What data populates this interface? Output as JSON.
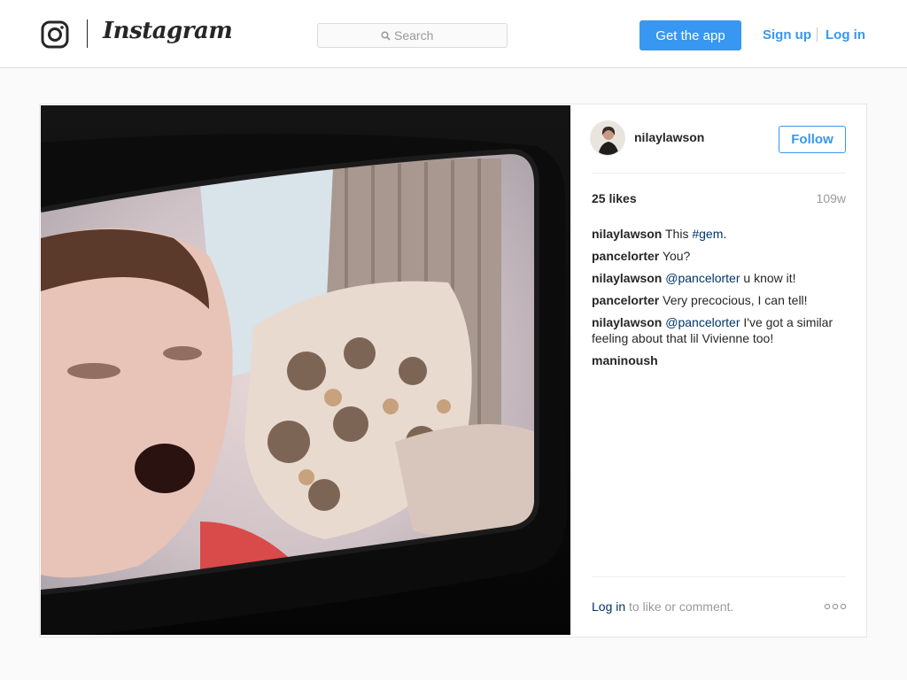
{
  "header": {
    "logo_text": "Instagram",
    "search_placeholder": "Search",
    "get_app_label": "Get the app",
    "sign_up_label": "Sign up",
    "log_in_label": "Log in"
  },
  "post": {
    "username": "nilaylawson",
    "follow_label": "Follow",
    "likes": "25 likes",
    "age": "109w",
    "comments": [
      {
        "user": "nilaylawson",
        "pre": " This ",
        "link": "#gem",
        "post": "."
      },
      {
        "user": "pancelorter",
        "pre": " You?",
        "link": "",
        "post": ""
      },
      {
        "user": "nilaylawson",
        "pre": " ",
        "link": "@pancelorter",
        "post": " u know it!"
      },
      {
        "user": "pancelorter",
        "pre": " Very precocious, I can tell!",
        "link": "",
        "post": ""
      },
      {
        "user": "nilaylawson",
        "pre": " ",
        "link": "@pancelorter",
        "post": " I've got a similar feeling about that lil Vivienne too!"
      },
      {
        "user": "maninoush",
        "pre": "",
        "link": "",
        "post": ""
      }
    ],
    "login_link": "Log in",
    "login_suffix": " to like or comment."
  },
  "colors": {
    "accent": "#3897f0",
    "link": "#003569",
    "muted": "#999999",
    "border": "#dbdbdb"
  },
  "icons": [
    "instagram-camera-icon",
    "search-icon",
    "more-options-icon"
  ]
}
